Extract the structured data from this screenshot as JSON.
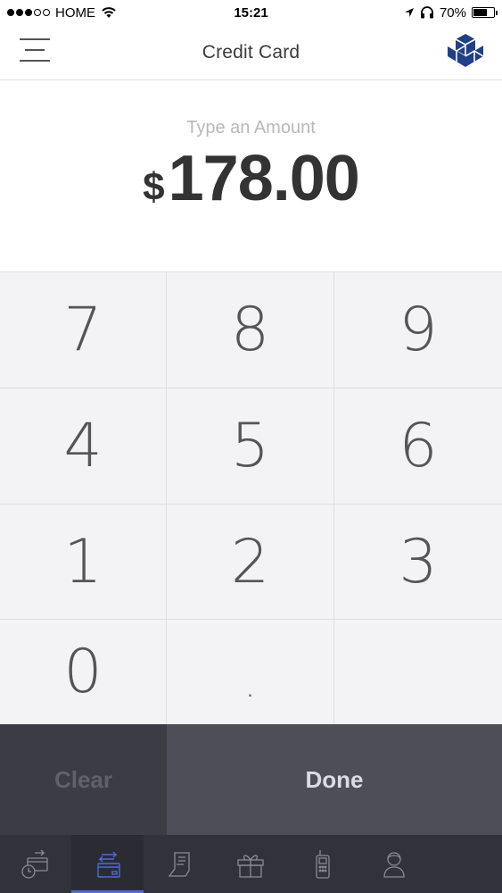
{
  "status_bar": {
    "carrier": "HOME",
    "time": "15:21",
    "battery_percent": "70%",
    "battery_level": 0.7,
    "signal_bars_filled": 3,
    "signal_bars_total": 5
  },
  "nav": {
    "title": "Credit Card",
    "menu_icon": "hamburger-menu-icon",
    "logo_icon": "cube-logo-icon"
  },
  "amount": {
    "label": "Type an Amount",
    "currency": "$",
    "value": "178.00"
  },
  "keypad": {
    "keys": [
      "7",
      "8",
      "9",
      "4",
      "5",
      "6",
      "1",
      "2",
      "3",
      "0",
      ".",
      ""
    ]
  },
  "actions": {
    "clear_label": "Clear",
    "done_label": "Done"
  },
  "tabs": [
    {
      "icon": "transaction-history-icon",
      "active": false
    },
    {
      "icon": "credit-card-transfer-icon",
      "active": true
    },
    {
      "icon": "receipt-icon",
      "active": false
    },
    {
      "icon": "gift-icon",
      "active": false
    },
    {
      "icon": "terminal-device-icon",
      "active": false
    },
    {
      "icon": "user-profile-icon",
      "active": false
    }
  ],
  "colors": {
    "accent": "#4a6cd6",
    "logo": "#1f3f8a",
    "action_bg": "#4d4e58",
    "tab_bg": "#32333a"
  }
}
